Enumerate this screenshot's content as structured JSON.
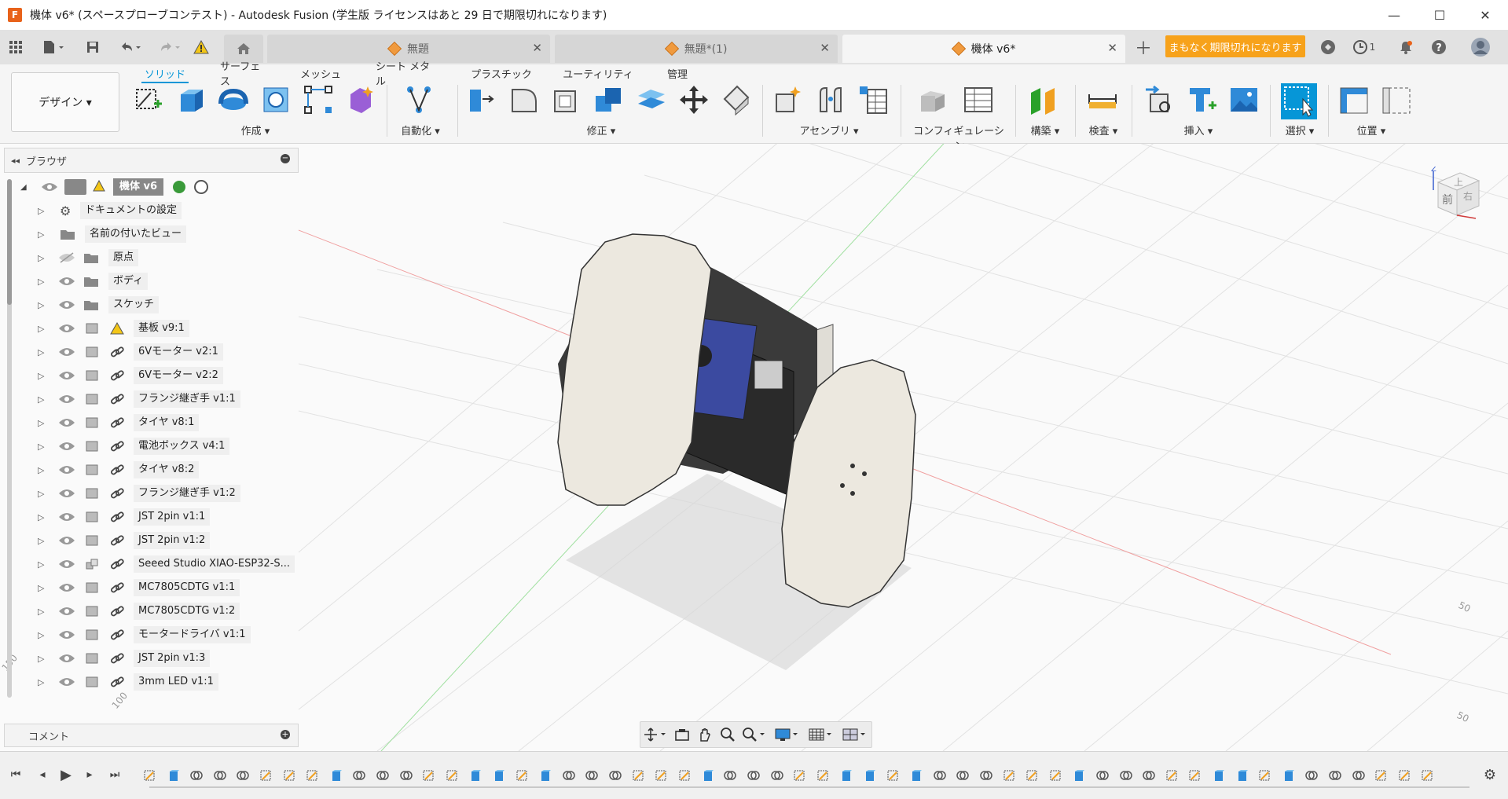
{
  "window": {
    "title": "機体 v6* (スペースプローブコンテスト) - Autodesk Fusion (学生版 ライセンスはあと 29 日で期限切れになります)",
    "app_icon_letter": "F",
    "controls": [
      "—",
      "☐",
      "✕"
    ]
  },
  "tabs": [
    {
      "label": "無題"
    },
    {
      "label": "無題*(1)"
    },
    {
      "label": "機体 v6*"
    }
  ],
  "expire_label": "まもなく期限切れになります",
  "job_count": "1",
  "ribbon": {
    "workspace_button": "デザイン ▾",
    "tabs": [
      "ソリッド",
      "サーフェス",
      "メッシュ",
      "シート メタル",
      "プラスチック",
      "ユーティリティ",
      "管理"
    ],
    "groups": [
      "作成 ▾",
      "自動化 ▾",
      "修正 ▾",
      "アセンブリ ▾",
      "コンフィギュレーション ▾",
      "構築 ▾",
      "検査 ▾",
      "挿入 ▾",
      "選択 ▾",
      "位置 ▾"
    ]
  },
  "browser": {
    "title": "ブラウザ",
    "root": "機体 v6",
    "items": [
      {
        "label": "ドキュメントの設定"
      },
      {
        "label": "名前の付いたビュー"
      },
      {
        "label": "原点"
      },
      {
        "label": "ボディ"
      },
      {
        "label": "スケッチ"
      },
      {
        "label": "基板 v9:1"
      },
      {
        "label": "6Vモーター v2:1"
      },
      {
        "label": "6Vモーター v2:2"
      },
      {
        "label": "フランジ継ぎ手 v1:1"
      },
      {
        "label": "タイヤ v8:1"
      },
      {
        "label": "電池ボックス v4:1"
      },
      {
        "label": "タイヤ v8:2"
      },
      {
        "label": "フランジ継ぎ手 v1:2"
      },
      {
        "label": "JST 2pin v1:1"
      },
      {
        "label": "JST 2pin v1:2"
      },
      {
        "label": "Seeed Studio XIAO-ESP32-S..."
      },
      {
        "label": "MC7805CDTG v1:1"
      },
      {
        "label": "MC7805CDTG v1:2"
      },
      {
        "label": "モータードライバ v1:1"
      },
      {
        "label": "JST 2pin v1:3"
      },
      {
        "label": "3mm LED v1:1"
      }
    ]
  },
  "comment_panel": "コメント",
  "viewcube": {
    "top": "上",
    "front": "前",
    "right": "右",
    "axis_z": "Z"
  },
  "grid_labels": [
    "50",
    "50",
    "150",
    "100"
  ],
  "colors": {
    "accent": "#0696d7",
    "expire": "#f7a21b",
    "brand": "#e8621a"
  }
}
